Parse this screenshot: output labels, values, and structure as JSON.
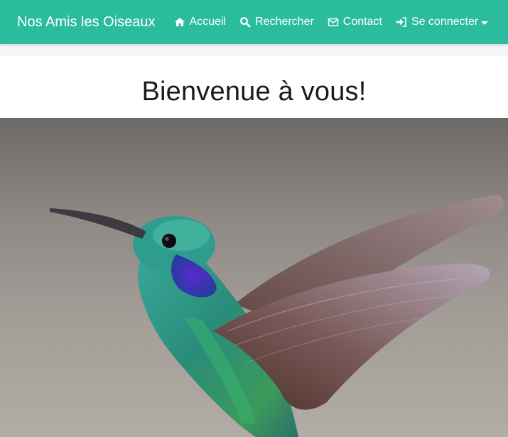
{
  "navbar": {
    "brand": "Nos Amis les Oiseaux",
    "links": [
      {
        "label": "Accueil",
        "icon": "home-icon"
      },
      {
        "label": "Rechercher",
        "icon": "search-icon"
      },
      {
        "label": "Contact",
        "icon": "envelope-icon"
      },
      {
        "label": "Se connecter",
        "icon": "sign-in-icon"
      }
    ],
    "color": "#2bbc9e"
  },
  "main": {
    "title": "Bienvenue à vous!"
  },
  "hero": {
    "subject": "hummingbird photo"
  }
}
